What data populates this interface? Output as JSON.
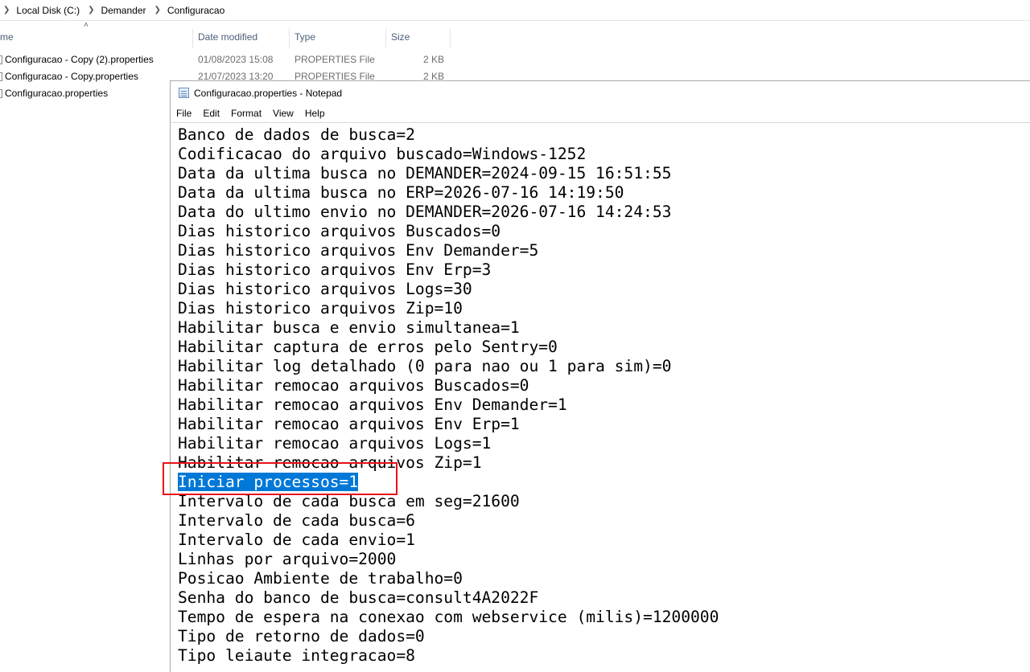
{
  "breadcrumb": [
    "Local Disk (C:)",
    "Demander",
    "Configuracao"
  ],
  "columns": {
    "name": "me",
    "date": "Date modified",
    "type": "Type",
    "size": "Size"
  },
  "files": [
    {
      "name": "Configuracao - Copy (2).properties",
      "date": "01/08/2023 15:08",
      "type": "PROPERTIES File",
      "size": "2 KB"
    },
    {
      "name": "Configuracao - Copy.properties",
      "date": "21/07/2023 13:20",
      "type": "PROPERTIES File",
      "size": "2 KB"
    },
    {
      "name": "Configuracao.properties",
      "date": "",
      "type": "",
      "size": ""
    }
  ],
  "notepad": {
    "title": "Configuracao.properties - Notepad",
    "menu": [
      "File",
      "Edit",
      "Format",
      "View",
      "Help"
    ],
    "selected_line": "Iniciar processos=1",
    "lines": [
      "Banco de dados de busca=2",
      "Codificacao do arquivo buscado=Windows-1252",
      "Data da ultima busca no DEMANDER=2024-09-15 16:51:55",
      "Data da ultima busca no ERP=2026-07-16 14:19:50",
      "Data do ultimo envio no DEMANDER=2026-07-16 14:24:53",
      "Dias historico arquivos Buscados=0",
      "Dias historico arquivos Env Demander=5",
      "Dias historico arquivos Env Erp=3",
      "Dias historico arquivos Logs=30",
      "Dias historico arquivos Zip=10",
      "Habilitar busca e envio simultanea=1",
      "Habilitar captura de erros pelo Sentry=0",
      "Habilitar log detalhado (0 para nao ou 1 para sim)=0",
      "Habilitar remocao arquivos Buscados=0",
      "Habilitar remocao arquivos Env Demander=1",
      "Habilitar remocao arquivos Env Erp=1",
      "Habilitar remocao arquivos Logs=1",
      "Habilitar remocao arquivos Zip=1",
      "Iniciar processos=1",
      "Intervalo de cada busca em seg=21600",
      "Intervalo de cada busca=6",
      "Intervalo de cada envio=1",
      "Linhas por arquivo=2000",
      "Posicao Ambiente de trabalho=0",
      "Senha do banco de busca=consult4A2022F",
      "Tempo de espera na conexao com webservice (milis)=1200000",
      "Tipo de retorno de dados=0",
      "Tipo leiaute integracao=8"
    ]
  }
}
